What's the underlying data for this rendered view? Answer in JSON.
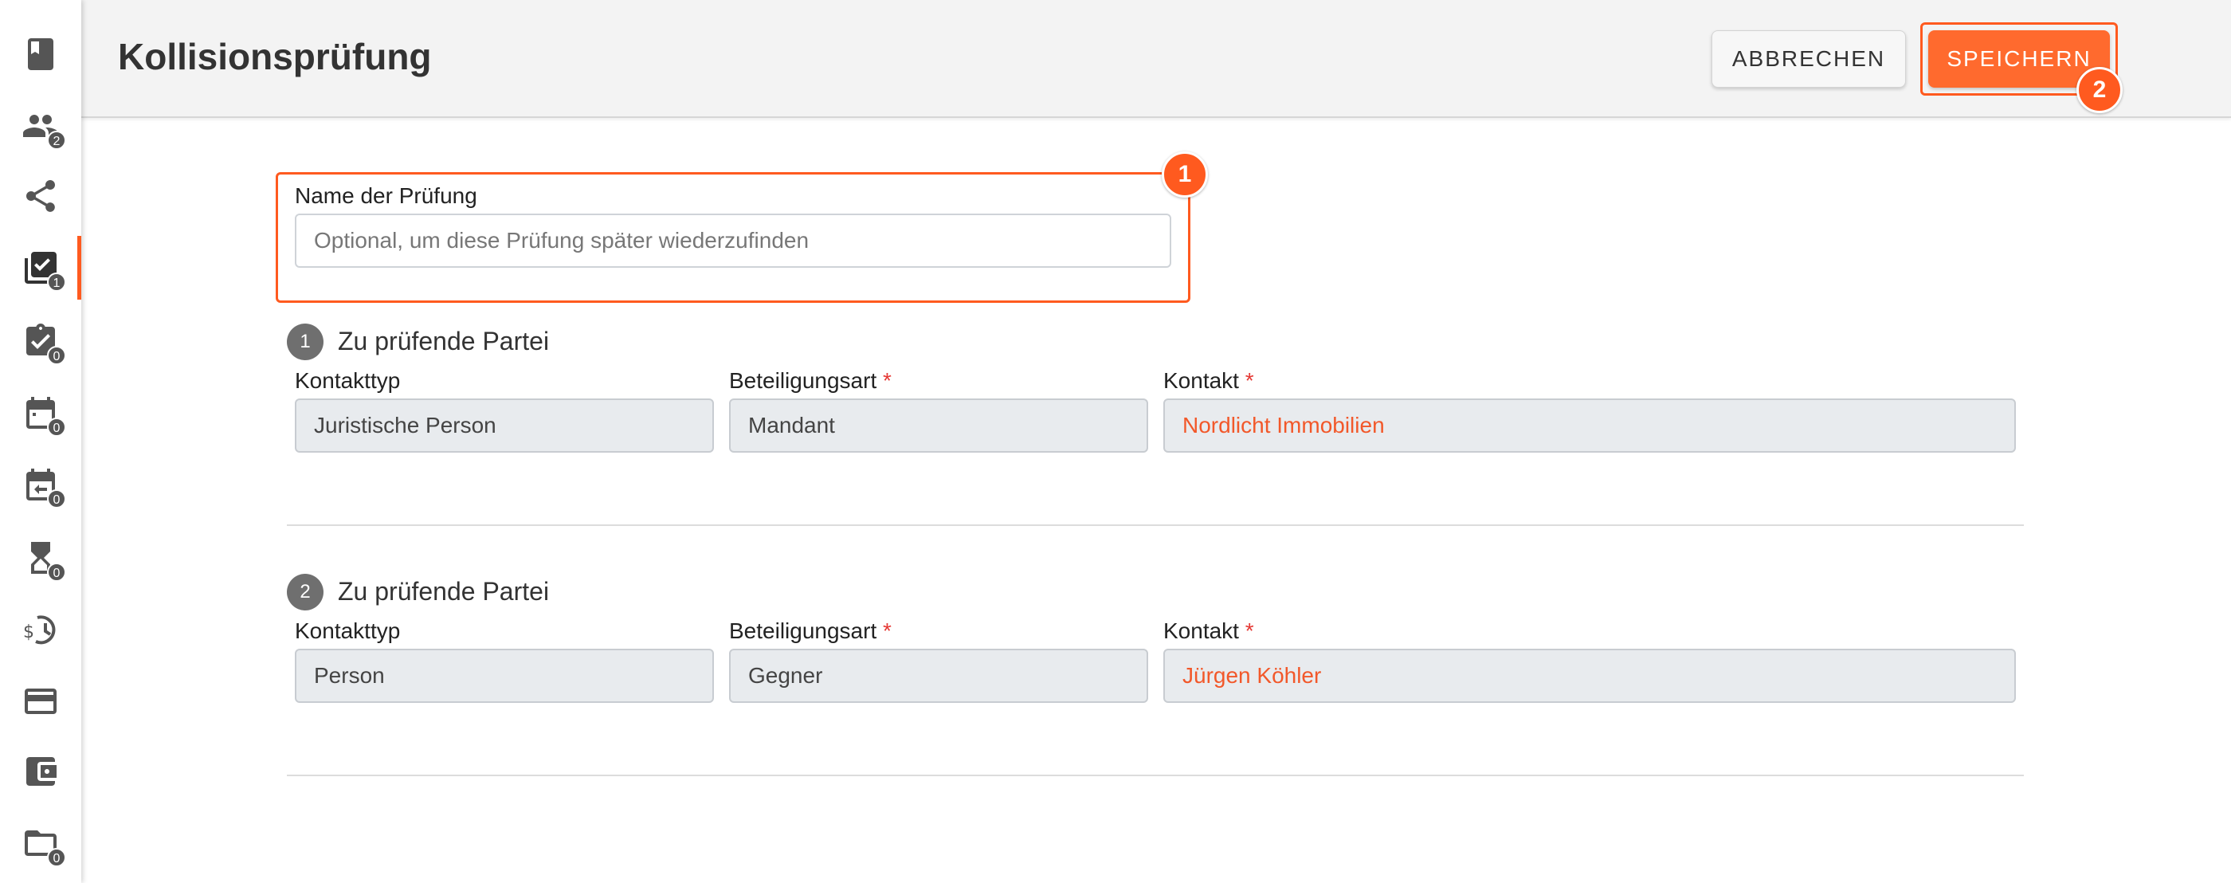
{
  "header": {
    "title": "Kollisionsprüfung",
    "cancel_label": "ABBRECHEN",
    "save_label": "SPEICHERN",
    "save_step": "2"
  },
  "sidebar": {
    "items": [
      {
        "icon": "book-icon",
        "badge": ""
      },
      {
        "icon": "people-icon",
        "badge": "2"
      },
      {
        "icon": "share-icon",
        "badge": ""
      },
      {
        "icon": "collision-check-icon",
        "badge": "1",
        "active": true
      },
      {
        "icon": "clipboard-check-icon",
        "badge": "0"
      },
      {
        "icon": "calendar-icon",
        "badge": "0"
      },
      {
        "icon": "calendar-return-icon",
        "badge": "0"
      },
      {
        "icon": "hourglass-icon",
        "badge": "0"
      },
      {
        "icon": "billing-history-icon",
        "badge": ""
      },
      {
        "icon": "credit-card-icon",
        "badge": ""
      },
      {
        "icon": "wallet-icon",
        "badge": ""
      },
      {
        "icon": "folder-icon",
        "badge": "0"
      }
    ]
  },
  "name_section": {
    "step": "1",
    "label": "Name der Prüfung",
    "placeholder": "Optional, um diese Prüfung später wiederzufinden",
    "value": ""
  },
  "parties": [
    {
      "number": "1",
      "title": "Zu prüfende Partei",
      "contact_type_label": "Kontakttyp",
      "contact_type_value": "Juristische Person",
      "participation_label": "Beteiligungsart",
      "participation_value": "Mandant",
      "contact_label": "Kontakt",
      "contact_value": "Nordlicht Immobilien",
      "required_mark": "*"
    },
    {
      "number": "2",
      "title": "Zu prüfende Partei",
      "contact_type_label": "Kontakttyp",
      "contact_type_value": "Person",
      "participation_label": "Beteiligungsart",
      "participation_value": "Gegner",
      "contact_label": "Kontakt",
      "contact_value": "Jürgen Köhler",
      "required_mark": "*"
    }
  ],
  "colors": {
    "accent": "#ff5a1f",
    "link_text": "#f2582a",
    "required": "#e53935"
  }
}
